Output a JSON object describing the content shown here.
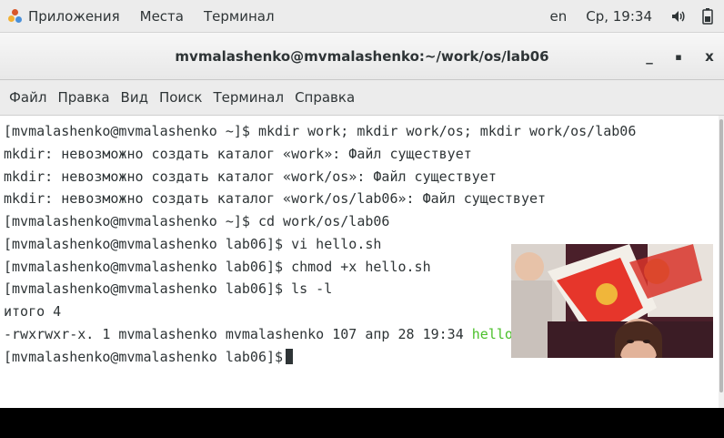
{
  "topbar": {
    "applications": "Приложения",
    "places": "Места",
    "terminal": "Терминал",
    "keyboard_layout": "en",
    "clock": "Ср, 19:34",
    "icons": [
      "volume-icon",
      "battery-icon"
    ]
  },
  "window": {
    "title": "mvmalashenko@mvmalashenko:~/work/os/lab06",
    "minimize": "_",
    "maximize": "▪",
    "close": "x"
  },
  "menubar": [
    "Файл",
    "Правка",
    "Вид",
    "Поиск",
    "Терминал",
    "Справка"
  ],
  "terminal": {
    "lines": [
      "[mvmalashenko@mvmalashenko ~]$ mkdir work; mkdir work/os; mkdir work/os/lab06",
      "mkdir: невозможно создать каталог «work»: Файл существует",
      "mkdir: невозможно создать каталог «work/os»: Файл существует",
      "mkdir: невозможно создать каталог «work/os/lab06»: Файл существует",
      "[mvmalashenko@mvmalashenko ~]$ cd work/os/lab06",
      "[mvmalashenko@mvmalashenko lab06]$ vi hello.sh",
      "[mvmalashenko@mvmalashenko lab06]$ chmod +x hello.sh",
      "[mvmalashenko@mvmalashenko lab06]$ ls -l",
      "итого 4"
    ],
    "ls_line_prefix": "-rwxrwxr-x. 1 mvmalashenko mvmalashenko 107 апр 28 19:34 ",
    "ls_line_file": "hello.sh",
    "prompt": "[mvmalashenko@mvmalashenko lab06]$"
  },
  "colors": {
    "executable_file": "#4bc02b",
    "terminal_bg": "#ffffff",
    "terminal_fg": "#2e3436"
  }
}
